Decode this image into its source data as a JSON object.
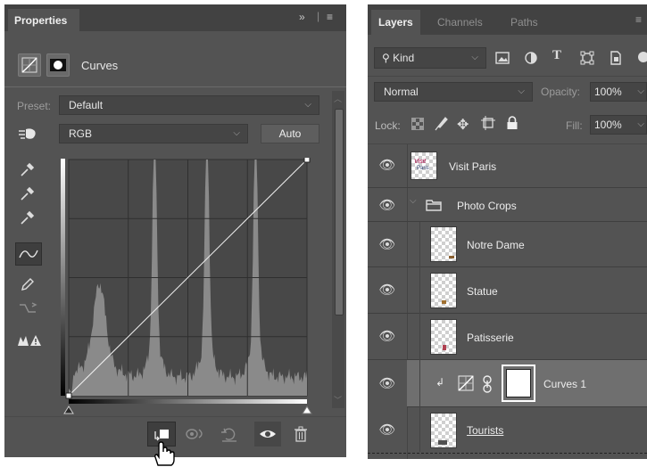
{
  "properties": {
    "tab_label": "Properties",
    "collapse_glyph": "»",
    "menu_glyph": "≡",
    "adjustment_name": "Curves",
    "preset_label": "Preset:",
    "preset_value": "Default",
    "channel_value": "RGB",
    "auto_label": "Auto",
    "tools": [
      "sample-in-image-black-icon",
      "sample-in-image-gray-icon",
      "sample-in-image-white-icon",
      "curve-points-icon",
      "pencil-icon",
      "smooth-icon",
      "clipping-warning-icon"
    ],
    "footer_buttons": [
      "clip-to-layer-icon",
      "view-previous-icon",
      "reset-icon",
      "visibility-icon",
      "delete-icon"
    ]
  },
  "chart_data": {
    "type": "area",
    "title": "",
    "xlabel": "",
    "ylabel": "",
    "xlim": [
      0,
      255
    ],
    "ylim": [
      0,
      255
    ],
    "curve": [
      [
        0,
        0
      ],
      [
        255,
        255
      ]
    ],
    "histogram_peaks": [
      {
        "x": 33,
        "height": 0.3
      },
      {
        "x": 92,
        "height": 0.98
      },
      {
        "x": 148,
        "height": 0.97
      },
      {
        "x": 200,
        "height": 0.98
      }
    ],
    "grid": true
  },
  "layers": {
    "tabs": [
      "Layers",
      "Channels",
      "Paths"
    ],
    "menu_glyph": "≡",
    "filter_label": "Kind",
    "blend_mode": "Normal",
    "opacity_label": "Opacity:",
    "opacity_value": "100%",
    "lock_label": "Lock:",
    "fill_label": "Fill:",
    "fill_value": "100%",
    "rows": [
      {
        "name": "Visit Paris"
      },
      {
        "name": "Photo Crops"
      },
      {
        "name": "Notre Dame"
      },
      {
        "name": "Statue"
      },
      {
        "name": "Patisserie"
      },
      {
        "name": "Curves 1"
      },
      {
        "name": "Tourists"
      }
    ]
  }
}
